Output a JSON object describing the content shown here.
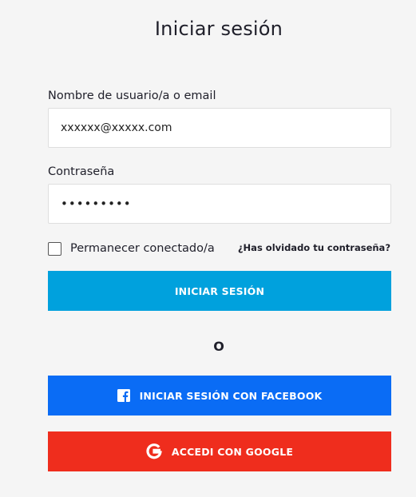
{
  "header": {
    "title": "Iniciar sesión"
  },
  "form": {
    "username_label": "Nombre de usuario/a o email",
    "username_value": "xxxxxx@xxxxx.com",
    "password_label": "Contraseña",
    "password_value": "•••••••••",
    "remember_label": "Permanecer conectado/a",
    "remember_checked": false,
    "forgot_link": "¿Has olvidado tu contraseña?",
    "login_button": "INICIAR SESIÓN",
    "or_text": "O",
    "facebook_button": "INICIAR SESIÓN CON FACEBOOK",
    "google_button": "ACCEDI CON GOOGLE"
  },
  "colors": {
    "background": "#f5f5f5",
    "login_button": "#00a1dd",
    "facebook_button": "#0a6cf5",
    "google_button": "#ef2d1d"
  },
  "icons": {
    "facebook": "facebook-icon",
    "google": "google-icon"
  }
}
